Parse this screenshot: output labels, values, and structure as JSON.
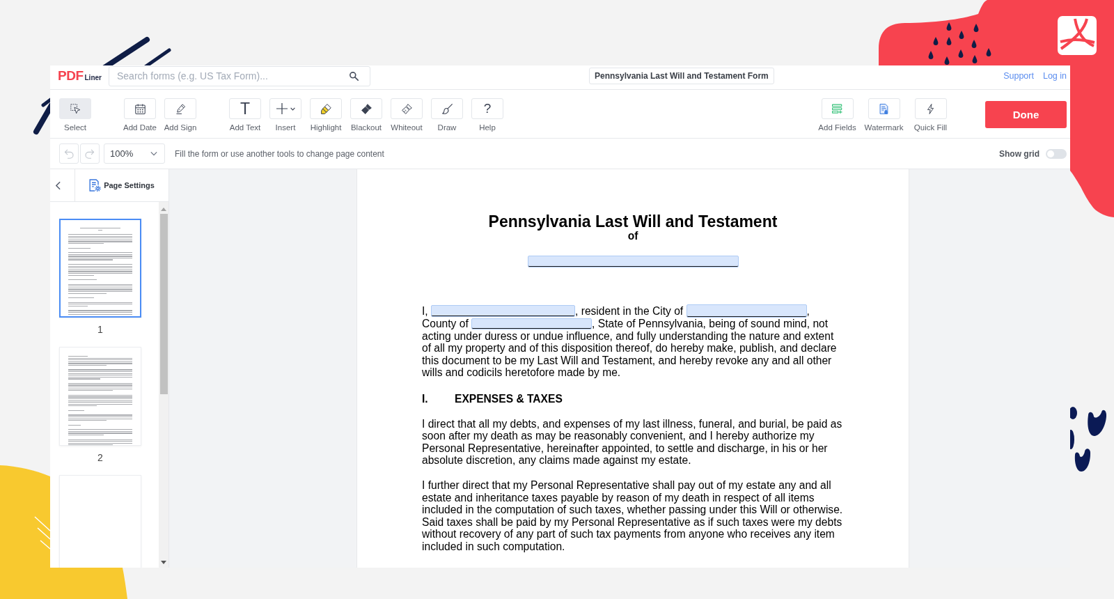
{
  "app_header": {
    "logo": {
      "brand": "PDF",
      "suffix": "Liner"
    },
    "search": {
      "placeholder": "Search forms (e.g. US Tax Form)..."
    },
    "document_title": "Pennsylvania Last Will and Testament Form",
    "links": [
      "Support",
      "Log in"
    ]
  },
  "toolbar": {
    "groups": [
      {
        "tools": [
          {
            "label": "Select",
            "selected": true,
            "dropdown": false
          }
        ]
      },
      {
        "tools": [
          {
            "label": "Add Date",
            "selected": false,
            "dropdown": false
          },
          {
            "label": "Add Sign",
            "selected": false,
            "dropdown": false
          }
        ]
      },
      {
        "tools": [
          {
            "label": "Add Text",
            "selected": false,
            "dropdown": false,
            "glyph": "T"
          },
          {
            "label": "Insert",
            "selected": false,
            "dropdown": true
          },
          {
            "label": "Highlight",
            "selected": false,
            "dropdown": false
          },
          {
            "label": "Blackout",
            "selected": false,
            "dropdown": false
          },
          {
            "label": "Whiteout",
            "selected": false,
            "dropdown": false
          },
          {
            "label": "Draw",
            "selected": false,
            "dropdown": false
          },
          {
            "label": "Help",
            "selected": false,
            "dropdown": false,
            "glyph": "?"
          }
        ]
      }
    ],
    "right_tools": [
      {
        "label": "Add Fields",
        "selected": false,
        "dropdown": false
      },
      {
        "label": "Watermark",
        "selected": false,
        "dropdown": false
      },
      {
        "label": "Quick Fill",
        "selected": false,
        "dropdown": false
      }
    ],
    "done_button": "Done"
  },
  "subbar": {
    "history_buttons": [
      {
        "disabled": true
      },
      {
        "disabled": true
      }
    ],
    "zoom": {
      "value": "100%"
    },
    "hint": "Fill the form or use another tools to change page content",
    "show_grid": {
      "label": "Show grid",
      "on": false
    }
  },
  "sidebar": {
    "page_settings": "Page Settings",
    "thumbnails": [
      {
        "label": "1",
        "selected": true,
        "kind": "text"
      },
      {
        "label": "2",
        "selected": false,
        "kind": "text"
      },
      {
        "selected": false,
        "kind": "blank"
      }
    ]
  },
  "document": {
    "heading": [
      {
        "kind": "title",
        "text": "Pennsylvania Last Will and Testament"
      },
      {
        "kind": "subtitle",
        "text": "of"
      },
      {
        "kind": "field"
      }
    ],
    "opening": [
      {
        "parts": [
          {
            "kind": "text",
            "text": "I,"
          },
          {
            "kind": "field"
          },
          {
            "kind": "text",
            "text": ", resident in the City of"
          },
          {
            "kind": "field"
          },
          {
            "kind": "text",
            "text": ","
          }
        ]
      },
      {
        "parts": [
          {
            "kind": "text",
            "text": "County of"
          },
          {
            "kind": "field"
          },
          {
            "kind": "text",
            "text": ", State of Pennsylvania, being of sound mind, not"
          }
        ]
      },
      {
        "parts": [
          {
            "kind": "text",
            "text": "acting under duress or undue influence, and fully understanding the nature and extent of all my property and of this disposition thereof, do hereby make, publish, and declare this document to be my Last Will and Testament, and hereby revoke any and all other wills and codicils heretofore made by me."
          }
        ]
      }
    ],
    "sections": [
      {
        "number": "I.",
        "title": "EXPENSES & TAXES",
        "paragraphs": [
          "I direct that all my debts, and expenses of my last illness, funeral, and burial, be paid as soon after my death as may be reasonably convenient, and I hereby authorize my Personal Representative, hereinafter appointed, to settle and discharge, in his or her absolute discretion, any claims made against my estate.",
          "I further direct that my Personal Representative shall pay out of my estate any and all estate and inheritance taxes payable by reason of my death in respect of all items included in the computation of such taxes, whether passing under this Will or otherwise. Said taxes shall be paid by my Personal Representative as if such taxes were my debts without recovery of any part of such tax payments from anyone who receives any item included in such computation."
        ]
      }
    ]
  }
}
